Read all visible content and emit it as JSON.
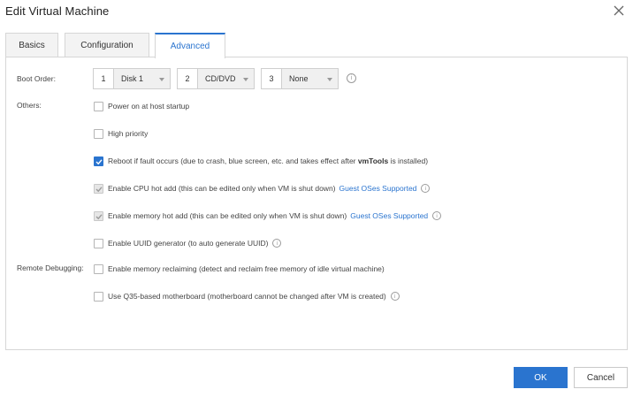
{
  "window": {
    "title": "Edit Virtual Machine"
  },
  "tabs": [
    {
      "label": "Basics",
      "active": false
    },
    {
      "label": "Configuration",
      "active": false
    },
    {
      "label": "Advanced",
      "active": true
    }
  ],
  "boot_order": {
    "label": "Boot Order:",
    "slots": [
      {
        "num": "1",
        "value": "Disk 1"
      },
      {
        "num": "2",
        "value": "CD/DVD"
      },
      {
        "num": "3",
        "value": "None"
      }
    ]
  },
  "others": {
    "label": "Others:",
    "options": [
      {
        "text": "Power on at host startup",
        "checked": false,
        "disabled": false
      },
      {
        "text": "High priority",
        "checked": false,
        "disabled": false
      },
      {
        "text_before": "Reboot if fault occurs (due to crash, blue screen, etc. and takes effect after ",
        "text_bold": "vmTools",
        "text_after": " is installed)",
        "checked": true,
        "disabled": false
      },
      {
        "text": "Enable CPU hot add (this can be edited only when VM is shut down)",
        "link": "Guest OSes Supported",
        "checked": true,
        "disabled": true
      },
      {
        "text": "Enable memory hot add (this can be edited only when VM is shut down)",
        "link": "Guest OSes Supported",
        "checked": true,
        "disabled": true
      },
      {
        "text": "Enable UUID generator (to auto generate UUID)",
        "checked": false,
        "disabled": false
      }
    ]
  },
  "remote_debugging": {
    "label": "Remote Debugging:",
    "options": [
      {
        "text": "Enable memory reclaiming (detect and reclaim free memory of idle virtual machine)",
        "checked": false
      },
      {
        "text": "Use Q35-based motherboard (motherboard cannot be changed after VM is created)",
        "checked": false
      }
    ]
  },
  "icons": {
    "info": "i",
    "close": "close-icon",
    "caret": "chevron-down-icon",
    "check": "check-icon"
  },
  "colors": {
    "accent": "#2a74cf"
  },
  "footer": {
    "ok_label": "OK",
    "cancel_label": "Cancel"
  }
}
